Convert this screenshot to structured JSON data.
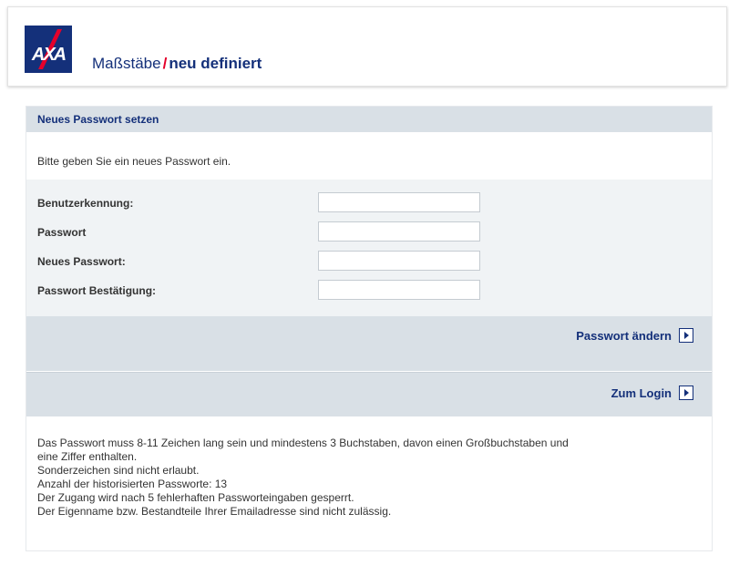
{
  "header": {
    "logo_text": "AXA",
    "tagline_part1": "Maßstäbe",
    "tagline_part2": "neu definiert",
    "brand_blue": "#14307a",
    "brand_red": "#e4002b"
  },
  "panel": {
    "title": "Neues Passwort setzen",
    "intro": "Bitte geben Sie ein neues Passwort ein.",
    "fields": [
      {
        "label": "Benutzerkennung:",
        "value": ""
      },
      {
        "label": "Passwort",
        "value": ""
      },
      {
        "label": "Neues Passwort:",
        "value": ""
      },
      {
        "label": "Passwort Bestätigung:",
        "value": ""
      }
    ],
    "change_password_label": "Passwort ändern",
    "to_login_label": "Zum Login",
    "info_lines": [
      "Das Passwort muss 8-11 Zeichen lang sein und mindestens 3 Buchstaben, davon einen Großbuchstaben und",
      "eine Ziffer enthalten.",
      "Sonderzeichen sind nicht erlaubt.",
      "Anzahl der historisierten Passworte: 13",
      "Der Zugang wird nach 5 fehlerhaften Passworteingaben gesperrt.",
      "Der Eigenname bzw. Bestandteile Ihrer Emailadresse sind nicht zulässig."
    ]
  }
}
